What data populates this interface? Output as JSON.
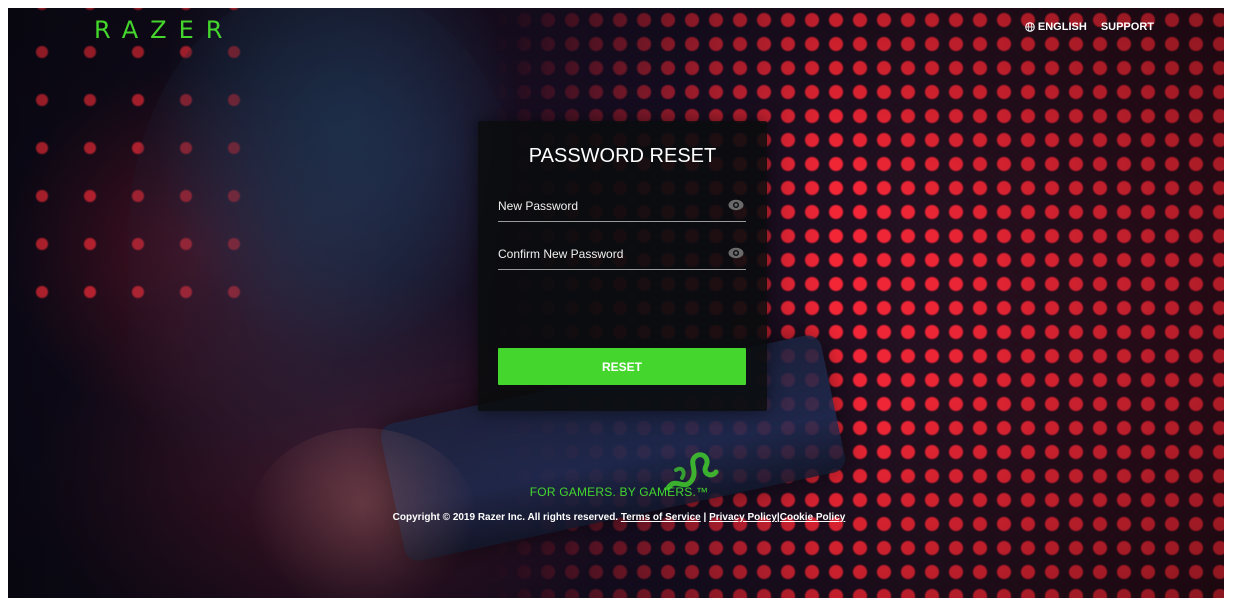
{
  "header": {
    "logo_text": "RAZER",
    "language_label": "ENGLISH",
    "support_label": "SUPPORT"
  },
  "form": {
    "title": "PASSWORD RESET",
    "new_password": {
      "placeholder": "New Password",
      "value": ""
    },
    "confirm_password": {
      "placeholder": "Confirm New Password",
      "value": ""
    },
    "reset_label": "RESET"
  },
  "footer": {
    "tagline": "FOR GAMERS. BY GAMERS.™",
    "copyright": "Copyright © 2019 Razer Inc. All rights reserved.",
    "terms_label": "Terms of Service",
    "separator": "|",
    "privacy_label": "Privacy Policy",
    "cookie_label": "Cookie Policy"
  },
  "colors": {
    "brand_green": "#44d62c",
    "card_background": "#0a0c0e",
    "led_red": "#ff2837"
  },
  "icons": {
    "language": "globe-icon",
    "password_visibility": "eye-icon",
    "brand": "razer-snake-icon"
  }
}
